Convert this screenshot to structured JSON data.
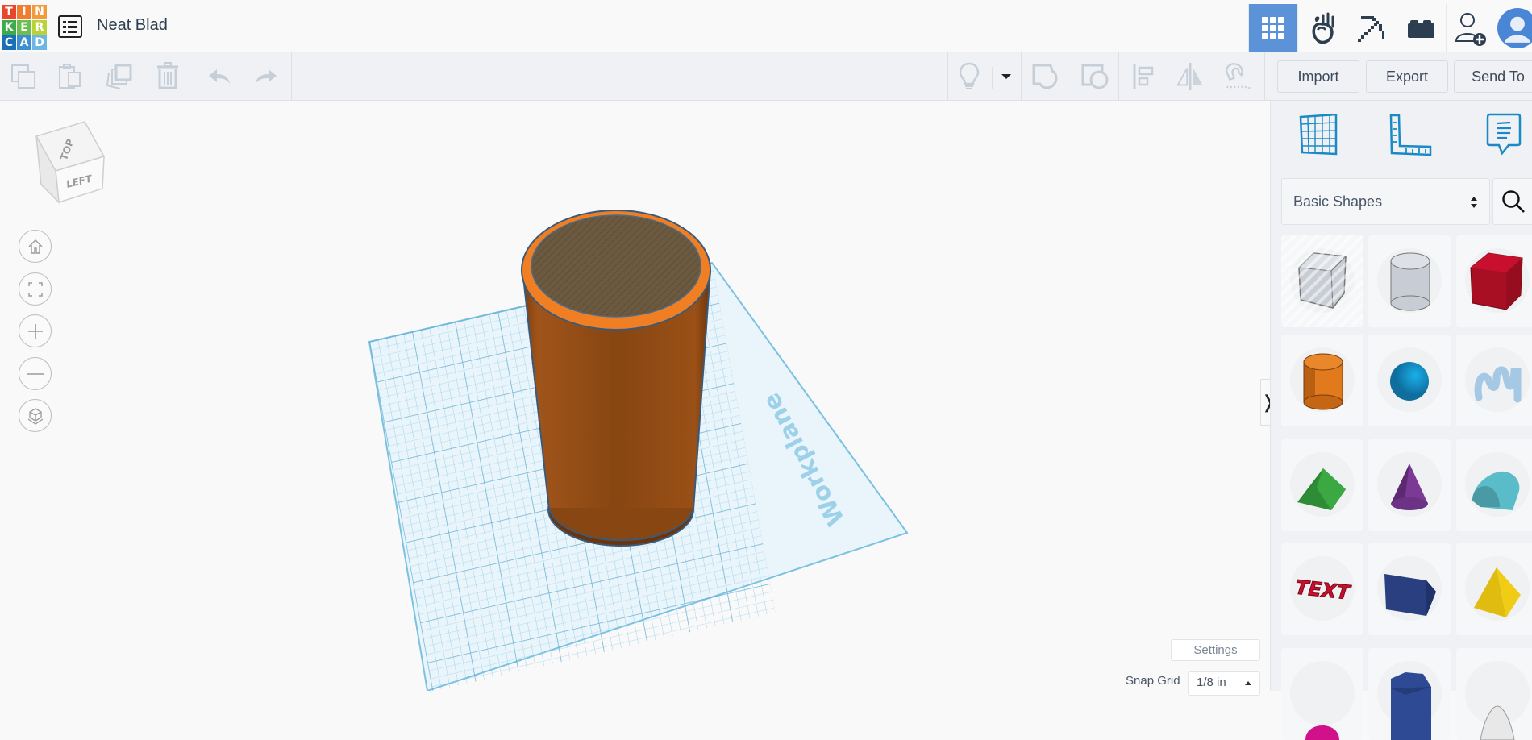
{
  "app": {
    "logo_letters": [
      "T",
      "I",
      "N",
      "K",
      "E",
      "R",
      "C",
      "A",
      "D"
    ],
    "logo_colors": [
      "#e8472b",
      "#f07c30",
      "#f39a3a",
      "#3faa4b",
      "#6cbf4c",
      "#b8d23a",
      "#1a6fb5",
      "#3d8fd1",
      "#6fb5e3"
    ],
    "project_title": "Neat Blad",
    "accent_color": "#5b92d8"
  },
  "header": {
    "buttons": [
      {
        "name": "3d-design",
        "icon": "grid-icon",
        "active": true
      },
      {
        "name": "blocks",
        "icon": "hand-apple-icon",
        "active": false
      },
      {
        "name": "minecraft",
        "icon": "pickaxe-icon",
        "active": false
      },
      {
        "name": "bricks",
        "icon": "brick-icon",
        "active": false
      },
      {
        "name": "invite",
        "icon": "add-user-icon",
        "active": false
      },
      {
        "name": "profile",
        "icon": "avatar-icon",
        "active": false
      }
    ]
  },
  "toolbar": {
    "edit_tools": [
      "copy",
      "paste",
      "duplicate",
      "delete",
      "undo",
      "redo"
    ],
    "view_tools": [
      "notes-lightbulb",
      "notes-dropdown",
      "group",
      "ungroup",
      "align",
      "mirror",
      "cruise"
    ],
    "import_label": "Import",
    "export_label": "Export",
    "send_to_label": "Send To"
  },
  "viewcube": {
    "top_label": "TOP",
    "left_label": "LEFT"
  },
  "nav_controls": [
    "home-view",
    "fit-all",
    "zoom-in",
    "zoom-out",
    "ortho-perspective"
  ],
  "workplane": {
    "label": "Workplane",
    "object": {
      "type": "cylinder",
      "color": "#c2651a"
    }
  },
  "panel": {
    "tabs": [
      "workplane",
      "ruler",
      "notes"
    ],
    "category_value": "Basic Shapes",
    "shapes": [
      {
        "name": "Box Hole",
        "color": "#c8ccd4"
      },
      {
        "name": "Cylinder Hole",
        "color": "#c8ccd4"
      },
      {
        "name": "Box",
        "color": "#c8102e"
      },
      {
        "name": "Cylinder",
        "color": "#e07a1c"
      },
      {
        "name": "Sphere",
        "color": "#1a9ad6"
      },
      {
        "name": "Scribble",
        "color": "#a5c8e4"
      },
      {
        "name": "Roof",
        "color": "#3ca842"
      },
      {
        "name": "Cone",
        "color": "#7b3a96"
      },
      {
        "name": "Round Roof",
        "color": "#5bbcc9"
      },
      {
        "name": "Text",
        "color": "#c8102e",
        "label": "TEXT"
      },
      {
        "name": "Wedge Prism",
        "color": "#2a3f80"
      },
      {
        "name": "Pyramid",
        "color": "#f0cc14"
      },
      {
        "name": "Half Sphere",
        "color": "#d0118a"
      },
      {
        "name": "Polygon",
        "color": "#2e4a95"
      },
      {
        "name": "Paraboloid",
        "color": "#e8e8e8"
      }
    ]
  },
  "footer": {
    "settings_label": "Settings",
    "snap_grid_label": "Snap Grid",
    "snap_grid_value": "1/8 in"
  }
}
